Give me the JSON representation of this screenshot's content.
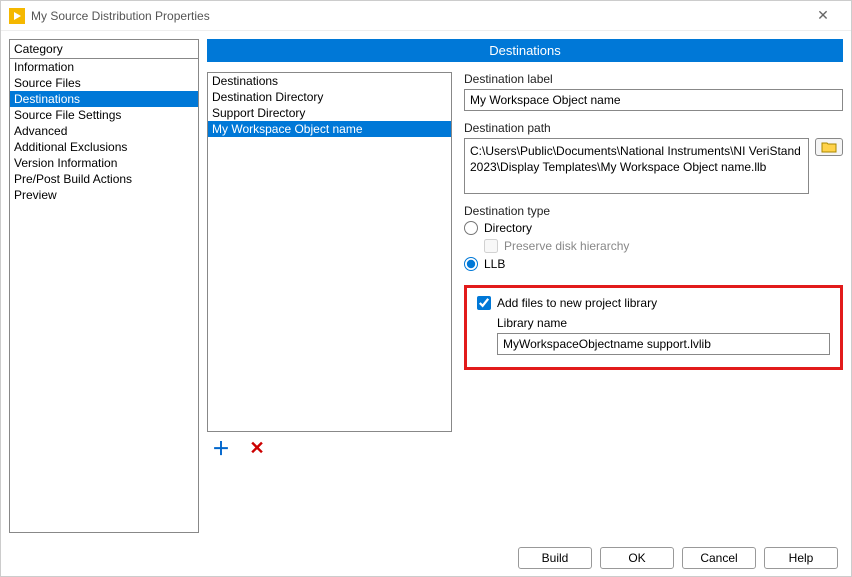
{
  "window": {
    "title": "My Source Distribution Properties",
    "close": "✕"
  },
  "category": {
    "header": "Category",
    "items": [
      "Information",
      "Source Files",
      "Destinations",
      "Source File Settings",
      "Advanced",
      "Additional Exclusions",
      "Version Information",
      "Pre/Post Build Actions",
      "Preview"
    ],
    "selected": 2
  },
  "banner": "Destinations",
  "destinations": {
    "items": [
      "Destinations",
      "Destination Directory",
      "Support Directory",
      "My Workspace Object name"
    ],
    "selected": 3
  },
  "form": {
    "label_field": {
      "label": "Destination label",
      "value": "My Workspace Object name"
    },
    "path_field": {
      "label": "Destination path",
      "value": "C:\\Users\\Public\\Documents\\National Instruments\\NI VeriStand 2023\\Display Templates\\My Workspace Object name.llb"
    },
    "type_field": {
      "label": "Destination type",
      "directory_label": "Directory",
      "preserve_label": "Preserve disk hierarchy",
      "llb_label": "LLB",
      "selected": "llb"
    },
    "library_field": {
      "checkbox_label": "Add files to new project library",
      "checked": true,
      "name_label": "Library name",
      "name_value": "MyWorkspaceObjectname support.lvlib"
    }
  },
  "buttons": {
    "build": "Build",
    "ok": "OK",
    "cancel": "Cancel",
    "help": "Help"
  }
}
